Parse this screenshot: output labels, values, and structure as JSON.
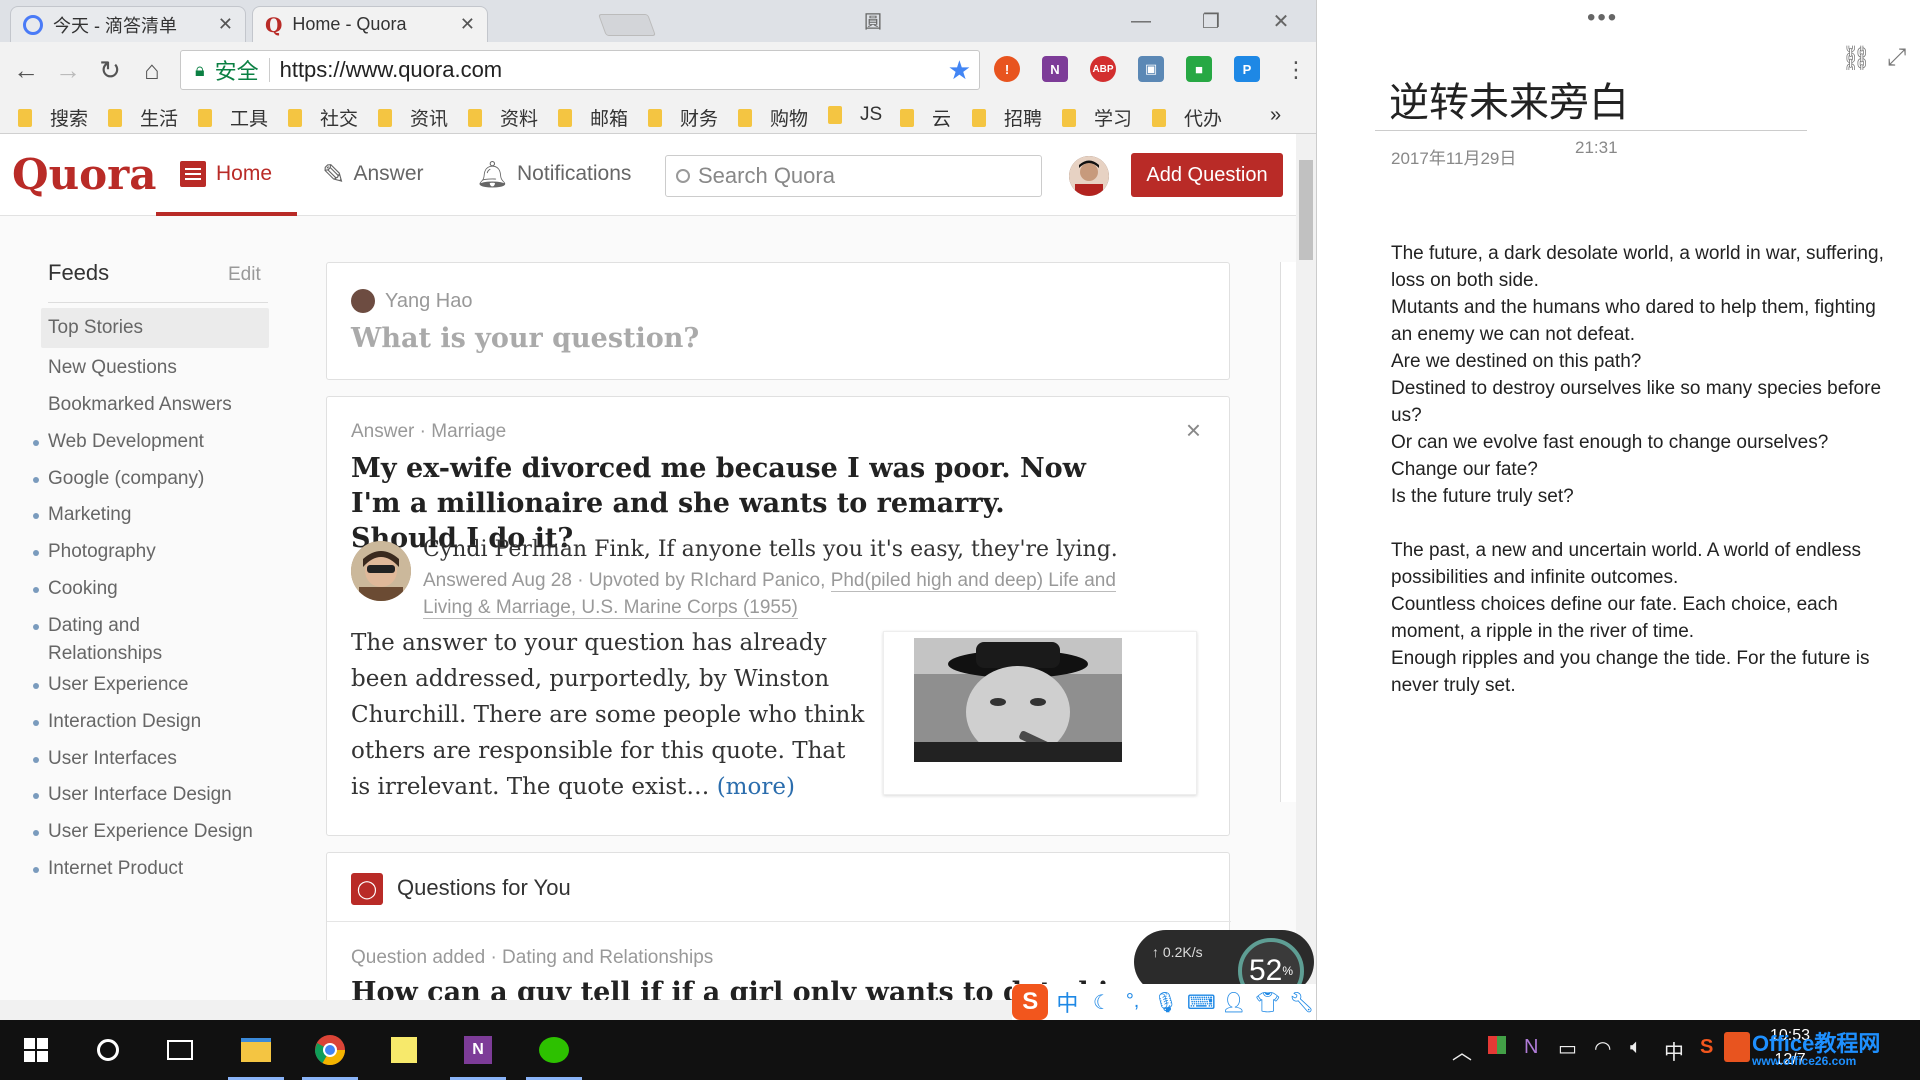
{
  "browser": {
    "tabs": [
      {
        "title": "今天 - 滴答清单",
        "icon": "check-icon"
      },
      {
        "title": "Home - Quora",
        "icon": "quora-icon"
      }
    ],
    "window_mark": "圓",
    "secure_label": "安全",
    "url": "https://www.quora.com",
    "bookmarks": [
      "搜索",
      "生活",
      "工具",
      "社交",
      "资讯",
      "资料",
      "邮箱",
      "财务",
      "购物",
      "JS",
      "云",
      "招聘",
      "学习",
      "代办"
    ],
    "bookmarks_more": "»",
    "extensions": [
      {
        "name": "alert",
        "label": "!",
        "color": "#e8541f"
      },
      {
        "name": "onenote",
        "label": "N",
        "color": "#7d3c98"
      },
      {
        "name": "adblock",
        "label": "ABP",
        "color": "#d32f2f"
      },
      {
        "name": "screenshot",
        "label": "▣",
        "color": "#5b88b5"
      },
      {
        "name": "green",
        "label": "■",
        "color": "#27a844"
      },
      {
        "name": "p-ext",
        "label": "P",
        "color": "#1e88e5"
      }
    ]
  },
  "quora": {
    "logo": "Quora",
    "nav": {
      "home": "Home",
      "answer": "Answer",
      "notifications": "Notifications"
    },
    "search_placeholder": "Search Quora",
    "add_question": "Add Question",
    "sidebar": {
      "title": "Feeds",
      "edit": "Edit",
      "top_items": [
        "Top Stories",
        "New Questions",
        "Bookmarked Answers"
      ],
      "topics": [
        "Web Development",
        "Google (company)",
        "Marketing",
        "Photography",
        "Cooking",
        "Dating and Relationships",
        "User Experience",
        "Interaction Design",
        "User Interfaces",
        "User Interface Design",
        "User Experience Design",
        "Internet Product"
      ]
    },
    "ask": {
      "user": "Yang Hao",
      "prompt": "What is your question?"
    },
    "answer_card": {
      "meta": "Answer · Marriage",
      "title": "My ex-wife divorced me because I was poor. Now I'm a millionaire and she wants to remarry. Should I do it?",
      "author": "Cyndi Perlman Fink, If anyone tells you it's easy, they're lying.",
      "answered": "Answered Aug 28 · Upvoted by ",
      "upvoter": "RIchard Panico,",
      "upvoter_cred": "Phd(piled high and deep) Life and Living & Marriage, U.S. Marine Corps (1955)",
      "body": "The answer to your question has already been addressed, purportedly, by Winston Churchill. There are some people who think others are responsible for this quote. That is irrelevant. The quote exist… ",
      "more": "(more)",
      "close": "×"
    },
    "questions_for_you": {
      "title": "Questions for You",
      "meta": "Question added · Dating and Relationships",
      "question": "How can a guy tell if if a girl only wants to date hi"
    }
  },
  "net_monitor": {
    "upload": "↑ 0.2K/s",
    "percent": "52",
    "percent_unit": "%"
  },
  "ime": {
    "label": "中"
  },
  "onenote": {
    "dots": "•••",
    "title": "逆转未来旁白",
    "date": "2017年11月29日",
    "time": "21:31",
    "para1": [
      "The future, a dark desolate world, a world in war, suffering, loss on both side.",
      "Mutants and the humans who dared to help them, fighting an enemy we can not defeat.",
      "Are we destined on this path?",
      "Destined to destroy ourselves like so many species before us?",
      "Or can we evolve fast enough to change ourselves?",
      "Change our fate?",
      "Is the future truly set?"
    ],
    "para2": [
      "The past, a new and uncertain world. A world of endless possibilities and infinite outcomes.",
      "Countless choices define our fate. Each choice, each moment, a ripple in the river of time.",
      "Enough ripples and you change the tide. For the future is never truly set."
    ]
  },
  "taskbar": {
    "tray_lang": "中",
    "clock_time": "10:53",
    "clock_date": "12/7",
    "watermark": "Office教程网",
    "watermark_sub": "www.office26.com"
  }
}
